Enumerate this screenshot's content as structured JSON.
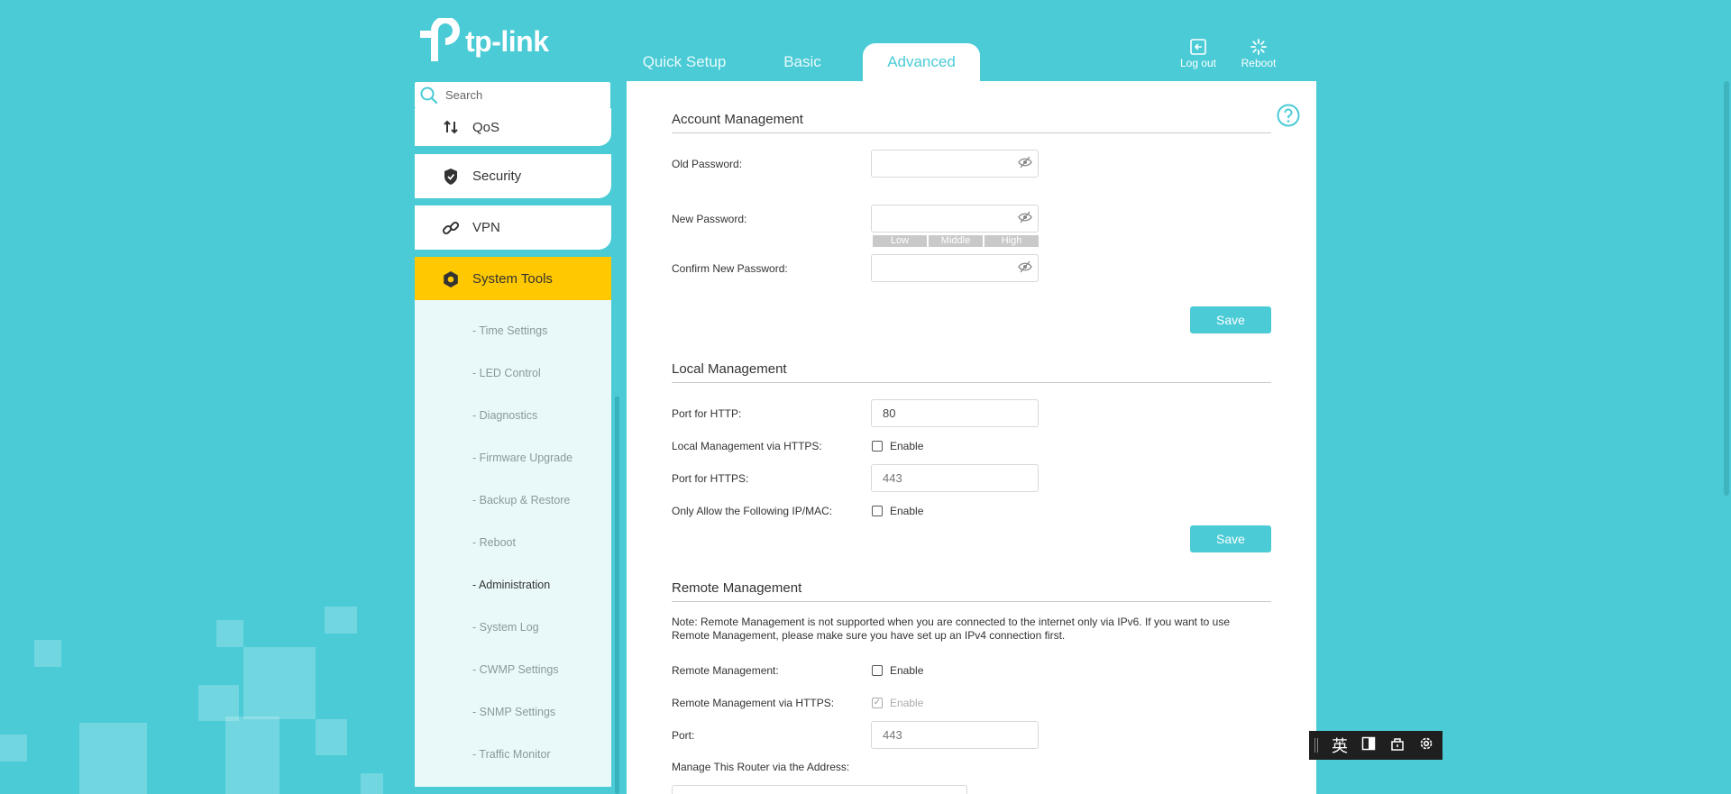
{
  "header": {
    "brand": "tp-link",
    "tabs": [
      {
        "label": "Quick Setup"
      },
      {
        "label": "Basic"
      },
      {
        "label": "Advanced"
      }
    ],
    "actions": {
      "logout": "Log out",
      "reboot": "Reboot"
    }
  },
  "sidebar": {
    "search_placeholder": "Search",
    "items": [
      {
        "label": "QoS",
        "icon": "qos-arrows-icon"
      },
      {
        "label": "Security",
        "icon": "shield-icon"
      },
      {
        "label": "VPN",
        "icon": "link-icon"
      },
      {
        "label": "System Tools",
        "icon": "gear-icon",
        "active": true
      }
    ],
    "submenu": [
      {
        "label": "- Time Settings"
      },
      {
        "label": "- LED Control"
      },
      {
        "label": "- Diagnostics"
      },
      {
        "label": "- Firmware Upgrade"
      },
      {
        "label": "- Backup & Restore"
      },
      {
        "label": "- Reboot"
      },
      {
        "label": "- Administration",
        "active": true
      },
      {
        "label": "- System Log"
      },
      {
        "label": "- CWMP Settings"
      },
      {
        "label": "- SNMP Settings"
      },
      {
        "label": "- Traffic Monitor"
      }
    ]
  },
  "account": {
    "title": "Account Management",
    "old_password_label": "Old Password:",
    "new_password_label": "New Password:",
    "confirm_password_label": "Confirm New Password:",
    "strength": [
      "Low",
      "Middle",
      "High"
    ],
    "save": "Save"
  },
  "local": {
    "title": "Local Management",
    "http_port_label": "Port for HTTP:",
    "http_port_value": "80",
    "https_label": "Local Management via HTTPS:",
    "https_enable": "Enable",
    "https_port_label": "Port for HTTPS:",
    "https_port_placeholder": "443",
    "ipmac_label": "Only Allow the Following IP/MAC:",
    "ipmac_enable": "Enable",
    "save": "Save"
  },
  "remote": {
    "title": "Remote Management",
    "note_line1": "Note: Remote Management is not supported when you are connected to the internet only via IPv6. If you want to use",
    "note_line2": "Remote Management, please make sure you have set up an IPv4 connection first.",
    "remote_label": "Remote Management:",
    "remote_enable": "Enable",
    "remote_https_label": "Remote Management via HTTPS:",
    "remote_https_enable": "Enable",
    "port_label": "Port:",
    "port_placeholder": "443",
    "address_label": "Manage This Router via the Address:"
  },
  "ime": {
    "lang": "英"
  },
  "colors": {
    "background": "#4acbd6",
    "accent": "#4acbd6",
    "active_item": "#ffc800"
  }
}
